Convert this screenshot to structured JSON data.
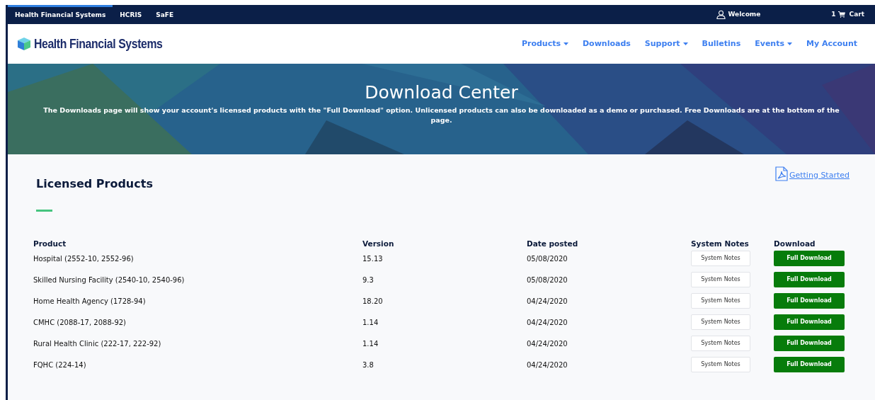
{
  "top_bar": {
    "tabs": [
      {
        "label": "Health Financial Systems",
        "selected": true
      },
      {
        "label": "HCRIS",
        "selected": false
      },
      {
        "label": "SaFE",
        "selected": false
      }
    ],
    "welcome": "Welcome",
    "cart_count": "1",
    "cart": "Cart"
  },
  "header": {
    "logo_text": "Health Financial Systems",
    "nav": [
      {
        "label": "Products",
        "dropdown": true
      },
      {
        "label": "Downloads",
        "dropdown": false
      },
      {
        "label": "Support",
        "dropdown": true
      },
      {
        "label": "Bulletins",
        "dropdown": false
      },
      {
        "label": "Events",
        "dropdown": true
      },
      {
        "label": "My Account",
        "dropdown": false
      }
    ]
  },
  "hero": {
    "title": "Download Center",
    "text": "The Downloads page will show your account's licensed products with the \"Full Download\" option. Unlicensed products can also be downloaded as a demo or purchased. Free Downloads are at the bottom of the page."
  },
  "section": {
    "title": "Licensed Products",
    "link": "Getting Started"
  },
  "table": {
    "columns": [
      "Product",
      "Version",
      "Date posted",
      "System Notes",
      "Download"
    ],
    "rows": [
      {
        "product": "Hospital (2552-10, 2552-96)",
        "version": "15.13",
        "date": "05/08/2020",
        "notes": "System Notes",
        "download": "Full Download"
      },
      {
        "product": "Skilled Nursing Facility (2540-10, 2540-96)",
        "version": "9.3",
        "date": "05/08/2020",
        "notes": "System Notes",
        "download": "Full Download"
      },
      {
        "product": "Home Health Agency (1728-94)",
        "version": "18.20",
        "date": "04/24/2020",
        "notes": "System Notes",
        "download": "Full Download"
      },
      {
        "product": "CMHC (2088-17, 2088-92)",
        "version": "1.14",
        "date": "04/24/2020",
        "notes": "System Notes",
        "download": "Full Download"
      },
      {
        "product": "Rural Health Clinic (222-17, 222-92)",
        "version": "1.14",
        "date": "04/24/2020",
        "notes": "System Notes",
        "download": "Full Download"
      },
      {
        "product": "FQHC (224-14)",
        "version": "3.8",
        "date": "04/24/2020",
        "notes": "System Notes",
        "download": "Full Download"
      }
    ]
  }
}
